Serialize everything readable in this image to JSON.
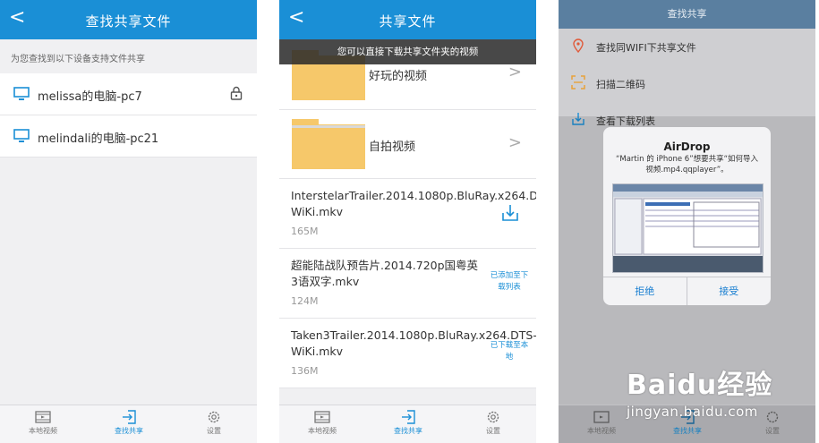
{
  "phone1": {
    "nav": {
      "back": "<",
      "title": "查找共享文件"
    },
    "hint": "为您查找到以下设备支持文件共享",
    "devices": [
      {
        "name": "melissa的电脑-pc7",
        "locked": true
      },
      {
        "name": "melindali的电脑-pc21",
        "locked": false
      }
    ]
  },
  "phone2": {
    "nav": {
      "back": "<",
      "title": "共享文件"
    },
    "toast": "您可以直接下载共享文件夹的视频",
    "folders": [
      {
        "name": "好玩的视频"
      },
      {
        "name": "自拍视频"
      }
    ],
    "files": [
      {
        "name": "InterstelarTrailer.2014.1080p.BluRay.x264.DTS-WiKi.mkv",
        "size": "165M",
        "status": ""
      },
      {
        "name": "超能陆战队预告片.2014.720p国粤英3语双字.mkv",
        "size": "124M",
        "status": "已添加至下载列表"
      },
      {
        "name": "Taken3Trailer.2014.1080p.BluRay.x264.DTS-WiKi.mkv",
        "size": "136M",
        "status": "已下载至本地"
      }
    ]
  },
  "phone3": {
    "nav_title": "查找共享",
    "menu": [
      {
        "label": "查找同WIFI下共享文件",
        "icon": "location-pin-icon"
      },
      {
        "label": "扫描二维码",
        "icon": "qr-scan-icon"
      },
      {
        "label": "查看下载列表",
        "icon": "download-icon"
      }
    ],
    "dialog": {
      "title": "AirDrop",
      "message": "“Martin 的 iPhone 6”想要共享“如何导入视频.mp4.qqplayer”。",
      "decline": "拒绝",
      "accept": "接受"
    }
  },
  "tabs": [
    {
      "label": "本地视频",
      "icon": "film-icon"
    },
    {
      "label": "查找共享",
      "icon": "share-enter-icon"
    },
    {
      "label": "设置",
      "icon": "gear-icon"
    }
  ],
  "watermark": {
    "brand": "Baidu经验",
    "url": "jingyan.baidu.com"
  },
  "colors": {
    "accent": "#1a8fd6",
    "folder": "#f6c86a"
  }
}
